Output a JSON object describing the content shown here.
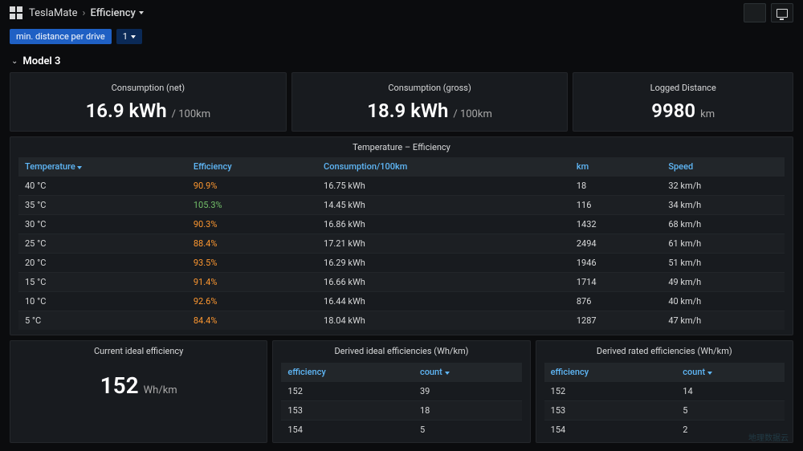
{
  "header": {
    "app": "TeslaMate",
    "page": "Efficiency",
    "sep": "›"
  },
  "variables": {
    "min_distance_label": "min. distance per drive",
    "min_distance_value": "1"
  },
  "section": {
    "title": "Model 3"
  },
  "stats": {
    "net": {
      "title": "Consumption (net)",
      "value": "16.9 kWh",
      "unit": "/ 100km"
    },
    "gross": {
      "title": "Consumption (gross)",
      "value": "18.9 kWh",
      "unit": "/ 100km"
    },
    "logged": {
      "title": "Logged Distance",
      "value": "9980",
      "unit": "km"
    }
  },
  "temp_eff": {
    "title": "Temperature – Efficiency",
    "cols": {
      "temperature": "Temperature",
      "efficiency": "Efficiency",
      "consumption": "Consumption/100km",
      "km": "km",
      "speed": "Speed"
    },
    "rows": [
      {
        "t": "40 °C",
        "eff": "90.9%",
        "eff_class": "eff-orange",
        "cons": "16.75 kWh",
        "km": "18",
        "speed": "32 km/h"
      },
      {
        "t": "35 °C",
        "eff": "105.3%",
        "eff_class": "eff-green",
        "cons": "14.45 kWh",
        "km": "116",
        "speed": "34 km/h"
      },
      {
        "t": "30 °C",
        "eff": "90.3%",
        "eff_class": "eff-orange",
        "cons": "16.86 kWh",
        "km": "1432",
        "speed": "68 km/h"
      },
      {
        "t": "25 °C",
        "eff": "88.4%",
        "eff_class": "eff-orange",
        "cons": "17.21 kWh",
        "km": "2494",
        "speed": "61 km/h"
      },
      {
        "t": "20 °C",
        "eff": "93.5%",
        "eff_class": "eff-orange",
        "cons": "16.29 kWh",
        "km": "1946",
        "speed": "51 km/h"
      },
      {
        "t": "15 °C",
        "eff": "91.4%",
        "eff_class": "eff-orange",
        "cons": "16.66 kWh",
        "km": "1714",
        "speed": "49 km/h"
      },
      {
        "t": "10 °C",
        "eff": "92.6%",
        "eff_class": "eff-orange",
        "cons": "16.44 kWh",
        "km": "876",
        "speed": "40 km/h"
      },
      {
        "t": "5 °C",
        "eff": "84.4%",
        "eff_class": "eff-orange",
        "cons": "18.04 kWh",
        "km": "1287",
        "speed": "47 km/h"
      }
    ]
  },
  "ideal": {
    "title": "Current ideal efficiency",
    "value": "152",
    "unit": "Wh/km"
  },
  "derived_ideal": {
    "title": "Derived ideal efficiencies (Wh/km)",
    "cols": {
      "efficiency": "efficiency",
      "count": "count"
    },
    "rows": [
      {
        "eff": "152",
        "count": "39"
      },
      {
        "eff": "153",
        "count": "18"
      },
      {
        "eff": "154",
        "count": "5"
      }
    ]
  },
  "derived_rated": {
    "title": "Derived rated efficiencies (Wh/km)",
    "cols": {
      "efficiency": "efficiency",
      "count": "count"
    },
    "rows": [
      {
        "eff": "152",
        "count": "14"
      },
      {
        "eff": "153",
        "count": "5"
      },
      {
        "eff": "154",
        "count": "2"
      }
    ]
  },
  "chart_data": [
    {
      "type": "table",
      "title": "Temperature – Efficiency",
      "columns": [
        "Temperature (°C)",
        "Efficiency (%)",
        "Consumption (kWh/100km)",
        "km",
        "Speed (km/h)"
      ],
      "rows": [
        [
          40,
          90.9,
          16.75,
          18,
          32
        ],
        [
          35,
          105.3,
          14.45,
          116,
          34
        ],
        [
          30,
          90.3,
          16.86,
          1432,
          68
        ],
        [
          25,
          88.4,
          17.21,
          2494,
          61
        ],
        [
          20,
          93.5,
          16.29,
          1946,
          51
        ],
        [
          15,
          91.4,
          16.66,
          1714,
          49
        ],
        [
          10,
          92.6,
          16.44,
          876,
          40
        ],
        [
          5,
          84.4,
          18.04,
          1287,
          47
        ]
      ]
    },
    {
      "type": "table",
      "title": "Derived ideal efficiencies (Wh/km)",
      "columns": [
        "efficiency",
        "count"
      ],
      "rows": [
        [
          152,
          39
        ],
        [
          153,
          18
        ],
        [
          154,
          5
        ]
      ]
    },
    {
      "type": "table",
      "title": "Derived rated efficiencies (Wh/km)",
      "columns": [
        "efficiency",
        "count"
      ],
      "rows": [
        [
          152,
          14
        ],
        [
          153,
          5
        ],
        [
          154,
          2
        ]
      ]
    }
  ]
}
